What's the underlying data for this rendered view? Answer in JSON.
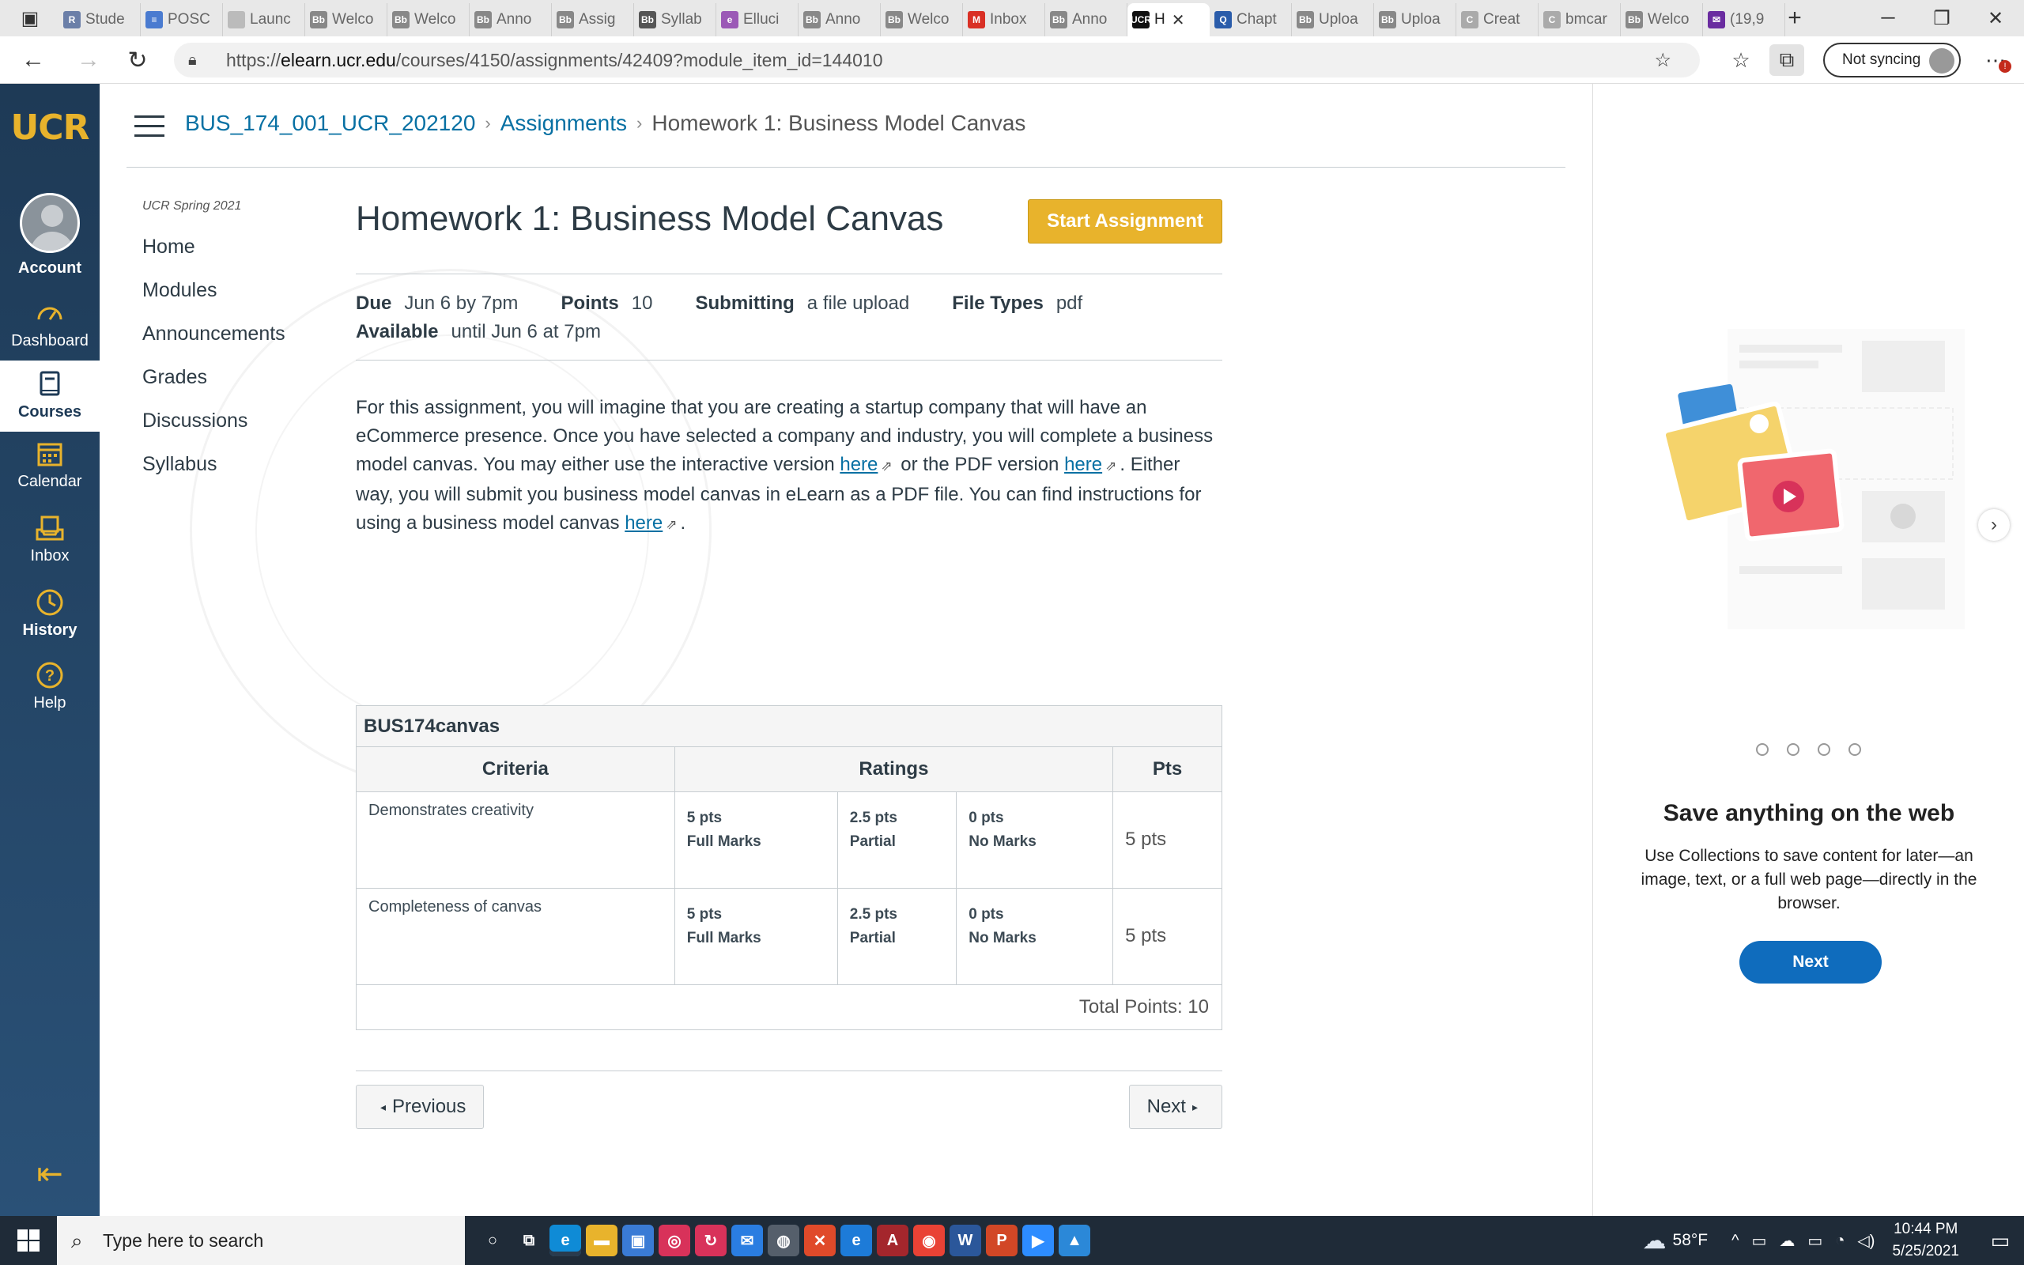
{
  "browser": {
    "tabs": [
      {
        "label": "Stude",
        "fav": "R",
        "color": "#6b7fa8"
      },
      {
        "label": "POSC",
        "fav": "≡",
        "color": "#4a7bd0"
      },
      {
        "label": "Launc",
        "fav": "",
        "color": "#bbbbbb"
      },
      {
        "label": "Welco",
        "fav": "Bb",
        "color": "#888888"
      },
      {
        "label": "Welco",
        "fav": "Bb",
        "color": "#888888"
      },
      {
        "label": "Anno",
        "fav": "Bb",
        "color": "#888888"
      },
      {
        "label": "Assig",
        "fav": "Bb",
        "color": "#888888"
      },
      {
        "label": "Syllab",
        "fav": "Bb",
        "color": "#555555"
      },
      {
        "label": "Elluci",
        "fav": "e",
        "color": "#9b59b6"
      },
      {
        "label": "Anno",
        "fav": "Bb",
        "color": "#888888"
      },
      {
        "label": "Welco",
        "fav": "Bb",
        "color": "#888888"
      },
      {
        "label": "Inbox",
        "fav": "M",
        "color": "#d93025"
      },
      {
        "label": "Anno",
        "fav": "Bb",
        "color": "#888888"
      },
      {
        "label": "H",
        "fav": "UCR",
        "color": "#111111"
      },
      {
        "label": "Chapt",
        "fav": "Q",
        "color": "#2a5caa"
      },
      {
        "label": "Uploa",
        "fav": "Bb",
        "color": "#888888"
      },
      {
        "label": "Uploa",
        "fav": "Bb",
        "color": "#888888"
      },
      {
        "label": "Creat",
        "fav": "C",
        "color": "#aaaaaa"
      },
      {
        "label": "bmcar",
        "fav": "C",
        "color": "#aaaaaa"
      },
      {
        "label": "Welco",
        "fav": "Bb",
        "color": "#888888"
      },
      {
        "label": "(19,9",
        "fav": "✉",
        "color": "#6a2ca0"
      }
    ],
    "active_tab_index": 13,
    "url_prefix": "https://",
    "url_host": "elearn.ucr.edu",
    "url_path": "/courses/4150/assignments/42409?module_item_id=144010",
    "sync_label": "Not syncing",
    "alert_badge": "!"
  },
  "global_nav": {
    "logo": "UCR",
    "items": [
      {
        "label": "Account",
        "icon": "avatar"
      },
      {
        "label": "Dashboard",
        "icon": "dashboard-icon"
      },
      {
        "label": "Courses",
        "icon": "book-icon"
      },
      {
        "label": "Calendar",
        "icon": "calendar-icon"
      },
      {
        "label": "Inbox",
        "icon": "inbox-icon"
      },
      {
        "label": "History",
        "icon": "clock-icon"
      },
      {
        "label": "Help",
        "icon": "help-icon"
      }
    ],
    "active": "Courses"
  },
  "breadcrumb": {
    "course": "BUS_174_001_UCR_202120",
    "section": "Assignments",
    "current": "Homework 1: Business Model Canvas"
  },
  "course_nav": {
    "term": "UCR Spring 2021",
    "items": [
      "Home",
      "Modules",
      "Announcements",
      "Grades",
      "Discussions",
      "Syllabus"
    ]
  },
  "assignment": {
    "title": "Homework 1: Business Model Canvas",
    "start_button": "Start Assignment",
    "due_label": "Due",
    "due_value": "Jun 6 by 7pm",
    "points_label": "Points",
    "points_value": "10",
    "submitting_label": "Submitting",
    "submitting_value": "a file upload",
    "file_types_label": "File Types",
    "file_types_value": "pdf",
    "available_label": "Available",
    "available_value": "until Jun 6 at 7pm",
    "description": {
      "part1": "For this assignment, you will imagine that you are creating a startup company that will have an eCommerce presence.  Once you have selected a company and industry, you will complete a business model canvas.  You may either use the interactive version ",
      "link1": "here",
      "part2": " or the PDF version ",
      "link2": "here",
      "part3": ".  Either way, you will submit you business model canvas in eLearn as a PDF file.  You can find instructions for using a business model canvas ",
      "link3": "here",
      "part4": "."
    }
  },
  "rubric": {
    "title": "BUS174canvas",
    "headers": {
      "criteria": "Criteria",
      "ratings": "Ratings",
      "pts": "Pts"
    },
    "rows": [
      {
        "criterion": "Demonstrates creativity",
        "ratings": [
          {
            "pts": "5 pts",
            "label": "Full Marks"
          },
          {
            "pts": "2.5 pts",
            "label": "Partial"
          },
          {
            "pts": "0 pts",
            "label": "No Marks"
          }
        ],
        "points": "5 pts"
      },
      {
        "criterion": "Completeness of canvas",
        "ratings": [
          {
            "pts": "5 pts",
            "label": "Full Marks"
          },
          {
            "pts": "2.5 pts",
            "label": "Partial"
          },
          {
            "pts": "0 pts",
            "label": "No Marks"
          }
        ],
        "points": "5 pts"
      }
    ],
    "total": "Total Points: 10"
  },
  "pager": {
    "previous": "Previous",
    "next": "Next"
  },
  "collections_panel": {
    "title": "Save anything on the web",
    "text": "Use Collections to save content for later—an image, text, or a full web page—directly in the browser.",
    "next_button": "Next",
    "dot_count": 4
  },
  "taskbar": {
    "search_placeholder": "Type here to search",
    "apps": [
      {
        "name": "cortana-icon",
        "glyph": "○",
        "color": "transparent"
      },
      {
        "name": "task-view-icon",
        "glyph": "⧉",
        "color": "transparent"
      },
      {
        "name": "edge-icon",
        "glyph": "e",
        "color": "#0f8bd6"
      },
      {
        "name": "file-explorer-icon",
        "glyph": "▬",
        "color": "#e8b32c"
      },
      {
        "name": "store-icon",
        "glyph": "▣",
        "color": "#3a7bd5"
      },
      {
        "name": "app-red-icon",
        "glyph": "◎",
        "color": "#d8325a"
      },
      {
        "name": "sync-app-icon",
        "glyph": "↻",
        "color": "#d8325a"
      },
      {
        "name": "mail-icon",
        "glyph": "✉",
        "color": "#2a7de1"
      },
      {
        "name": "globe-icon",
        "glyph": "◍",
        "color": "#555f6b"
      },
      {
        "name": "app-x-icon",
        "glyph": "✕",
        "color": "#e04a2a"
      },
      {
        "name": "ie-icon",
        "glyph": "e",
        "color": "#1d7bd8"
      },
      {
        "name": "access-icon",
        "glyph": "A",
        "color": "#a4262c"
      },
      {
        "name": "chrome-icon",
        "glyph": "◉",
        "color": "#e94235"
      },
      {
        "name": "word-icon",
        "glyph": "W",
        "color": "#2b579a"
      },
      {
        "name": "powerpoint-icon",
        "glyph": "P",
        "color": "#d24726"
      },
      {
        "name": "zoom-icon",
        "glyph": "▶",
        "color": "#2d8cff"
      },
      {
        "name": "photos-icon",
        "glyph": "▲",
        "color": "#2b88d8"
      }
    ],
    "weather": "58°F",
    "time": "10:44 PM",
    "date": "5/25/2021"
  }
}
